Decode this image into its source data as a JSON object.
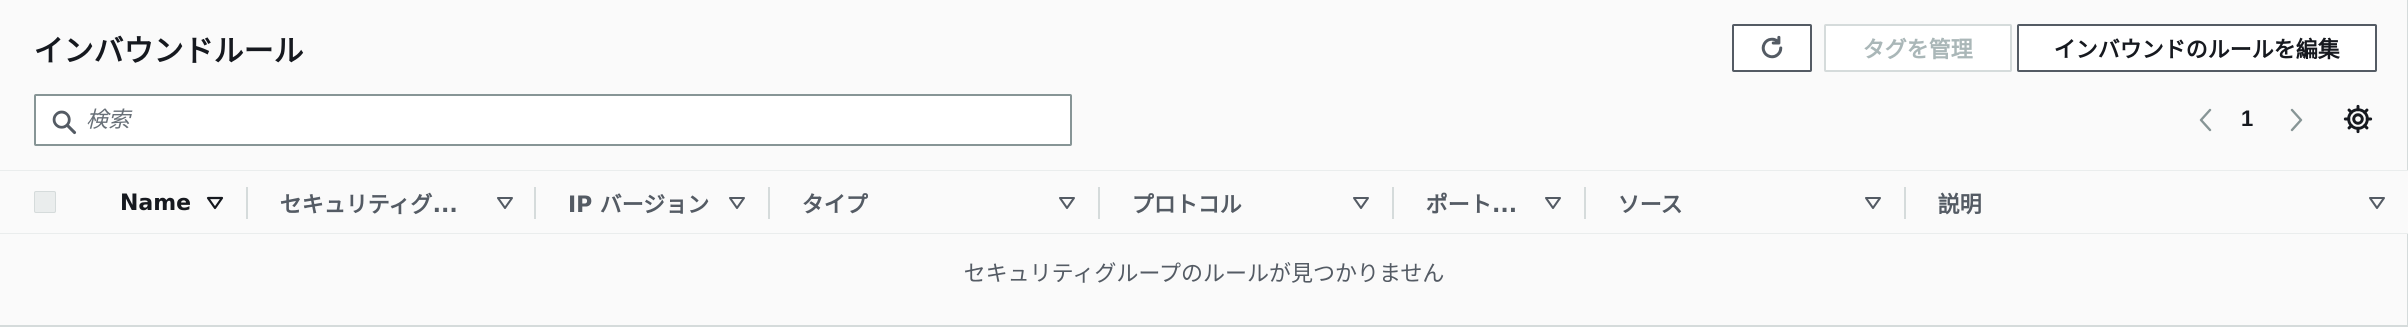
{
  "header": {
    "title": "インバウンドルール",
    "buttons": {
      "refresh_icon": "refresh-icon",
      "manage_tags": "タグを管理",
      "edit_inbound_rules": "インバウンドのルールを編集"
    }
  },
  "search": {
    "placeholder": "検索",
    "value": ""
  },
  "pagination": {
    "current_page": "1"
  },
  "table": {
    "columns": [
      {
        "label": "Name"
      },
      {
        "label": "セキュリティグ..."
      },
      {
        "label": "IP バージョン"
      },
      {
        "label": "タイプ"
      },
      {
        "label": "プロトコル"
      },
      {
        "label": "ポート..."
      },
      {
        "label": "ソース"
      },
      {
        "label": "説明"
      }
    ],
    "empty_message": "セキュリティグループのルールが見つかりません"
  },
  "colors": {
    "border_primary": "#545b64",
    "border_disabled": "#d5dbdb",
    "text_disabled": "#aab7b8",
    "text_secondary": "#545b64"
  }
}
